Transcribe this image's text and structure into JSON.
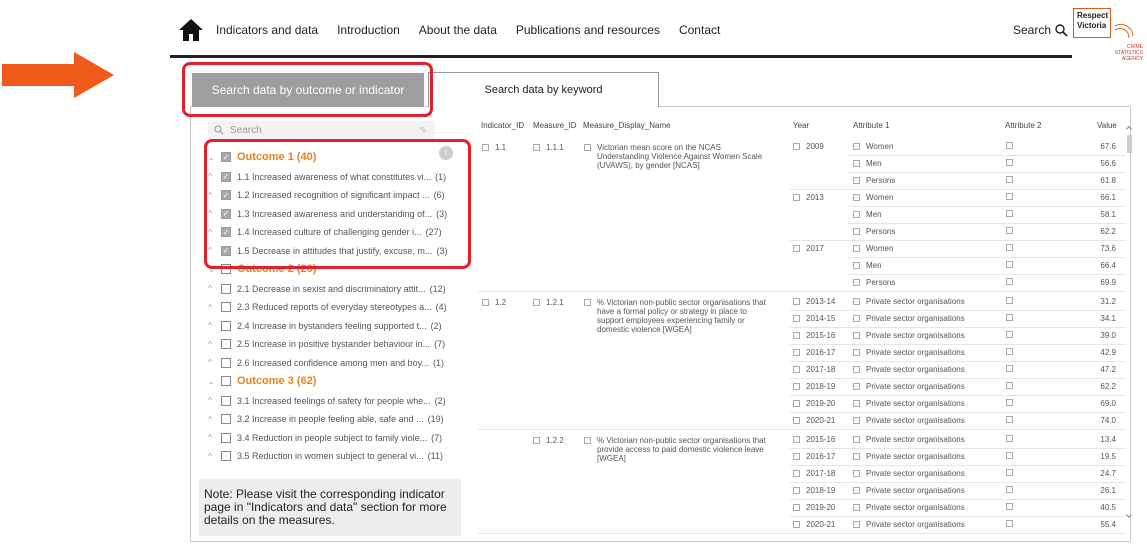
{
  "header": {
    "nav": [
      "Indicators and data",
      "Introduction",
      "About the data",
      "Publications and resources",
      "Contact"
    ],
    "search_label": "Search",
    "logo_line1": "Respect",
    "logo_line2": "Victoria",
    "logo_sub1": "CRIME",
    "logo_sub2": "STATISTICS",
    "logo_sub3": "AGENCY"
  },
  "tabs": {
    "active": "Search data by outcome or indicator",
    "inactive": "Search data by keyword"
  },
  "sidebar": {
    "search_placeholder": "Search",
    "outcomes": [
      {
        "label": "Outcome 1 (40)",
        "checked": true,
        "items": [
          {
            "text": "1.1 Increased awareness of what constitutes vi...",
            "count": "(1)",
            "checked": true
          },
          {
            "text": "1.2 Increased recognition of significant impact ...",
            "count": "(6)",
            "checked": true
          },
          {
            "text": "1.3 Increased awareness and understanding of...",
            "count": "(3)",
            "checked": true
          },
          {
            "text": "1.4 Increased culture of challenging gender i...",
            "count": "(27)",
            "checked": true
          },
          {
            "text": "1.5 Decrease in attitudes that justify, excuse, m...",
            "count": "(3)",
            "checked": true
          }
        ]
      },
      {
        "label": "Outcome 2 (20)",
        "checked": false,
        "items": [
          {
            "text": "2.1 Decrease in sexist and discriminatory attit...",
            "count": "(12)",
            "checked": false
          },
          {
            "text": "2.3 Reduced reports of everyday stereotypes a...",
            "count": "(4)",
            "checked": false
          },
          {
            "text": "2.4 Increase in bystanders feeling supported t...",
            "count": "(2)",
            "checked": false
          },
          {
            "text": "2.5 Increase in positive bystander behaviour in...",
            "count": "(7)",
            "checked": false
          },
          {
            "text": "2.6 Increased confidence among men and boy...",
            "count": "(1)",
            "checked": false
          }
        ]
      },
      {
        "label": "Outcome 3 (62)",
        "checked": false,
        "items": [
          {
            "text": "3.1 Increased feelings of safety for people whe...",
            "count": "(2)",
            "checked": false
          },
          {
            "text": "3.2 Increase in people feeling able, safe and ...",
            "count": "(19)",
            "checked": false
          },
          {
            "text": "3.4 Reduction in people subject to family viole...",
            "count": "(7)",
            "checked": false
          },
          {
            "text": "3.5 Reduction in women subject to general vi...",
            "count": "(11)",
            "checked": false
          }
        ]
      }
    ],
    "note": "Note: Please visit the corresponding indicator page in \"Indicators and data\" section for more details on the measures."
  },
  "table": {
    "headers": [
      "Indicator_ID",
      "Measure_ID",
      "Measure_Display_Name",
      "Year",
      "Attribute 1",
      "Attribute 2",
      "Value"
    ],
    "groups": [
      {
        "indicator": "1.1",
        "measure": "1.1.1",
        "description": "Victorian mean score on the NCAS Understanding Violence Against Women Scale (UVAWS), by gender [NCAS]",
        "rows": [
          {
            "year": "2009",
            "attr1": "Women",
            "value": "67.6"
          },
          {
            "year": "",
            "attr1": "Men",
            "value": "56.6"
          },
          {
            "year": "",
            "attr1": "Persons",
            "value": "61.8"
          },
          {
            "year": "2013",
            "attr1": "Women",
            "value": "66.1"
          },
          {
            "year": "",
            "attr1": "Men",
            "value": "58.1"
          },
          {
            "year": "",
            "attr1": "Persons",
            "value": "62.2"
          },
          {
            "year": "2017",
            "attr1": "Women",
            "value": "73.6"
          },
          {
            "year": "",
            "attr1": "Men",
            "value": "66.4"
          },
          {
            "year": "",
            "attr1": "Persons",
            "value": "69.9"
          }
        ]
      },
      {
        "indicator": "1.2",
        "measure": "1.2.1",
        "description": "% Victorian non-public sector organisations that have a formal policy or strategy in place to support employees experiencing family or domestic violence [WGEA]",
        "rows": [
          {
            "year": "2013-14",
            "attr1": "Private sector organisations",
            "value": "31.2"
          },
          {
            "year": "2014-15",
            "attr1": "Private sector organisations",
            "value": "34.1"
          },
          {
            "year": "2015-16",
            "attr1": "Private sector organisations",
            "value": "39.0"
          },
          {
            "year": "2016-17",
            "attr1": "Private sector organisations",
            "value": "42.9"
          },
          {
            "year": "2017-18",
            "attr1": "Private sector organisations",
            "value": "47.2"
          },
          {
            "year": "2018-19",
            "attr1": "Private sector organisations",
            "value": "62.2"
          },
          {
            "year": "2019-20",
            "attr1": "Private sector organisations",
            "value": "69.0"
          },
          {
            "year": "2020-21",
            "attr1": "Private sector organisations",
            "value": "74.0"
          }
        ]
      },
      {
        "indicator": "",
        "measure": "1.2.2",
        "description": "% Victorian non-public sector organisations that provide access to paid domestic violence leave [WGEA]",
        "rows": [
          {
            "year": "2015-16",
            "attr1": "Private sector organisations",
            "value": "13.4"
          },
          {
            "year": "2016-17",
            "attr1": "Private sector organisations",
            "value": "19.5"
          },
          {
            "year": "2017-18",
            "attr1": "Private sector organisations",
            "value": "24.7"
          },
          {
            "year": "2018-19",
            "attr1": "Private sector organisations",
            "value": "26.1"
          },
          {
            "year": "2019-20",
            "attr1": "Private sector organisations",
            "value": "40.5"
          },
          {
            "year": "2020-21",
            "attr1": "Private sector organisations",
            "value": "55.4"
          }
        ]
      }
    ]
  },
  "colors": {
    "arrow": "#f05a1a",
    "highlight": "#e0202a",
    "outcome": "#e8821e",
    "tab_active_bg": "#9e9e9e"
  }
}
